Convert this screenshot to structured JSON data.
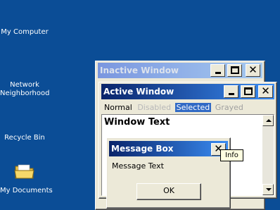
{
  "desktop": {
    "background": "#0b4d96",
    "icons": [
      {
        "label": "My Computer"
      },
      {
        "label": "Network Neighborhood"
      },
      {
        "label": "Recycle Bin"
      },
      {
        "label": "My Documents",
        "icon": "folder-icon"
      }
    ]
  },
  "inactive_window": {
    "title": "Inactive Window",
    "title_gradient": [
      "#7a96df",
      "#a6caf0"
    ],
    "title_color": "#d4d0c8"
  },
  "active_window": {
    "title": "Active Window",
    "title_gradient": [
      "#0a246a",
      "#3a8cf2"
    ],
    "menu": {
      "normal": "Normal",
      "disabled": "Disabled",
      "selected": "Selected",
      "grayed": "Grayed"
    },
    "window_text": "Window Text"
  },
  "message_box": {
    "title": "Message Box",
    "text": "Message Text",
    "ok_label": "OK",
    "tooltip": "Info"
  },
  "colors": {
    "selected_bg": "#316ac5",
    "disabled_text": "#a0a0a0",
    "face": "#ece9d8"
  }
}
